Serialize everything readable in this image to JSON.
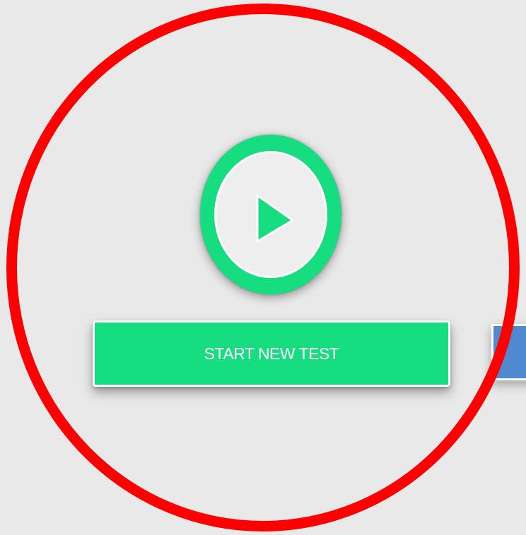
{
  "main": {
    "start_button": {
      "label": "START NEW TEST"
    },
    "play_button": {
      "icon": "play-icon"
    },
    "side_button": {
      "color": "#4f8ad0"
    }
  },
  "overlay": {
    "highlight_color": "#ff0000"
  },
  "colors": {
    "accent": "#16dd7f",
    "background": "#e9e9e9",
    "secondary": "#4f8ad0"
  }
}
